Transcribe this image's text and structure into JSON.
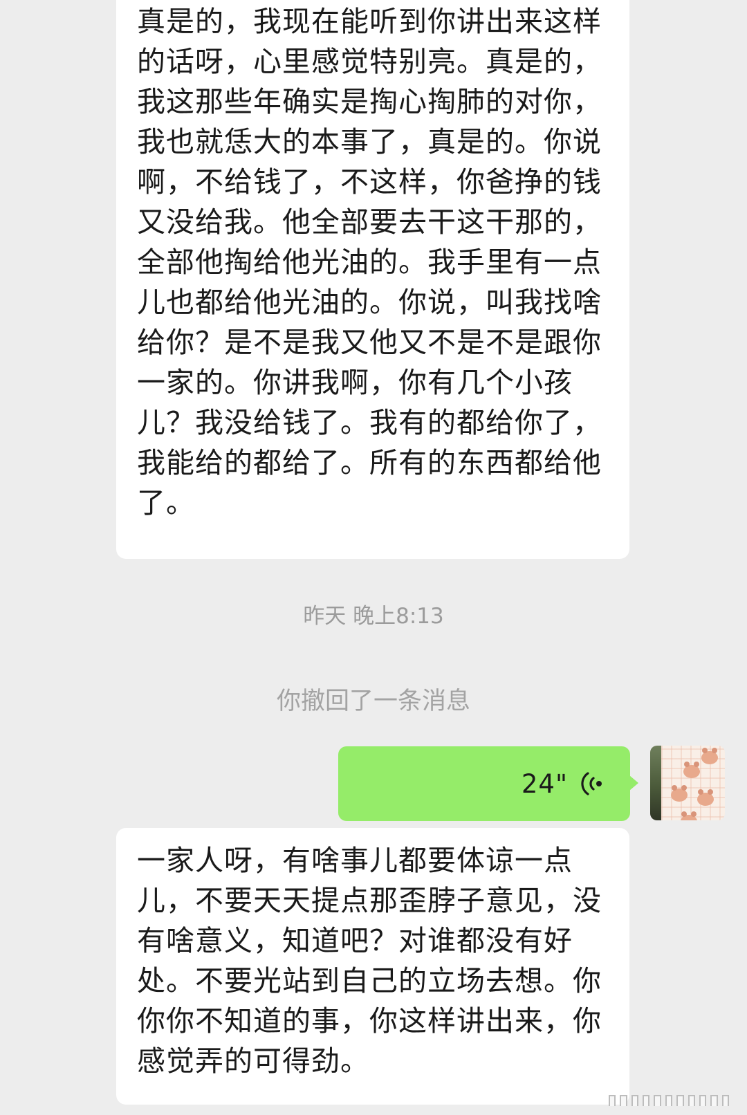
{
  "messages": {
    "top_text": "真是的，我现在能听到你讲出来这样的话呀，心里感觉特别亮。真是的，我这那些年确实是掏心掏肺的对你，我也就恁大的本事了，真是的。你说啊，不给钱了，不这样，你爸挣的钱又没给我。他全部要去干这干那的，全部他掏给他光油的。我手里有一点儿也都给他光油的。你说，叫我找啥给你？是不是我又他又不是不是跟你一家的。你讲我啊，你有几个小孩儿？我没给钱了。我有的都给你了，我能给的都给了。所有的东西都给他了。",
    "bottom_text": "一家人呀，有啥事儿都要体谅一点儿，不要天天提点那歪脖子意见，没有啥意义，知道吧？对谁都没有好处。不要光站到自己的立场去想。你你你不知道的事，你这样讲出来，你感觉弄的可得劲。"
  },
  "timestamp": "昨天 晚上8:13",
  "system_notice": "你撤回了一条消息",
  "voice_message": {
    "duration": "24\"",
    "icon": "voice-wave-icon",
    "bubble_color": "#95ec69"
  },
  "avatar": {
    "icon": "bear-pattern-avatar"
  },
  "colors": {
    "background": "#ededed",
    "incoming_bubble": "#ffffff",
    "outgoing_bubble": "#95ec69",
    "meta_text": "#9b9b9b"
  }
}
